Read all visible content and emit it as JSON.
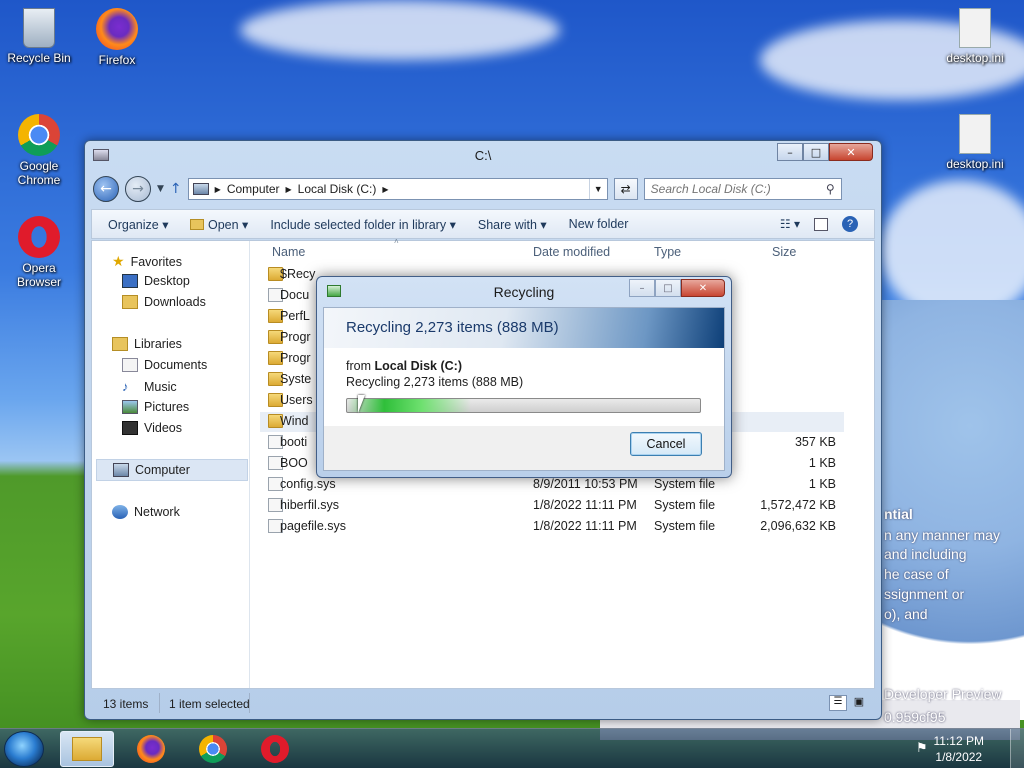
{
  "desktop": {
    "icons": [
      {
        "label": "Recycle Bin"
      },
      {
        "label": "Firefox"
      },
      {
        "label": "Google Chrome"
      },
      {
        "label": "Opera Browser"
      },
      {
        "label": "desktop.ini"
      },
      {
        "label": "desktop.ini"
      }
    ],
    "wallpaper_text": {
      "line1": "ntial",
      "line2": "n any manner may",
      "line3": "and including",
      "line4": "he case of",
      "line5": "ssignment or",
      "line6": "o), and",
      "line7": "Developer Preview",
      "line8": "0.959cf95"
    }
  },
  "explorer": {
    "title": "C:\\",
    "address": {
      "crumbs": [
        "Computer",
        "Local Disk (C:)"
      ]
    },
    "search": {
      "placeholder": "Search Local Disk (C:)"
    },
    "toolbar": {
      "organize": "Organize",
      "open": "Open",
      "include": "Include selected folder in library",
      "share": "Share with",
      "new_folder": "New folder"
    },
    "nav": {
      "favorites": "Favorites",
      "desktop": "Desktop",
      "downloads": "Downloads",
      "libraries": "Libraries",
      "documents": "Documents",
      "music": "Music",
      "pictures": "Pictures",
      "videos": "Videos",
      "computer": "Computer",
      "network": "Network"
    },
    "columns": {
      "name": "Name",
      "date": "Date modified",
      "type": "Type",
      "size": "Size"
    },
    "rows": [
      {
        "name": "$Recy",
        "date": "",
        "type": "",
        "size": ""
      },
      {
        "name": "Docu",
        "date": "",
        "type": "",
        "size": ""
      },
      {
        "name": "PerfL",
        "date": "",
        "type": "",
        "size": ""
      },
      {
        "name": "Progr",
        "date": "",
        "type": "",
        "size": ""
      },
      {
        "name": "Progr",
        "date": "",
        "type": "",
        "size": ""
      },
      {
        "name": "Syste",
        "date": "",
        "type": "",
        "size": ""
      },
      {
        "name": "Users",
        "date": "",
        "type": "",
        "size": ""
      },
      {
        "name": "Wind",
        "date": "",
        "type": "",
        "size": ""
      },
      {
        "name": "booti",
        "date": "",
        "type": "",
        "size": "357 KB"
      },
      {
        "name": "BOO",
        "date": "",
        "type": "",
        "size": "1 KB"
      },
      {
        "name": "config.sys",
        "date": "8/9/2011 10:53 PM",
        "type": "System file",
        "size": "1 KB"
      },
      {
        "name": "hiberfil.sys",
        "date": "1/8/2022 11:11 PM",
        "type": "System file",
        "size": "1,572,472 KB"
      },
      {
        "name": "pagefile.sys",
        "date": "1/8/2022 11:11 PM",
        "type": "System file",
        "size": "2,096,632 KB"
      }
    ],
    "status": {
      "count": "13 items",
      "selected": "1 item selected"
    }
  },
  "dialog": {
    "title": "Recycling",
    "banner": "Recycling 2,273 items (888 MB)",
    "from_label": "from",
    "from_value": "Local Disk (C:)",
    "detail": "Recycling 2,273 items (888 MB)",
    "cancel": "Cancel",
    "progress": 0.35
  },
  "taskbar": {
    "clock_time": "11:12 PM",
    "clock_date": "1/8/2022"
  }
}
